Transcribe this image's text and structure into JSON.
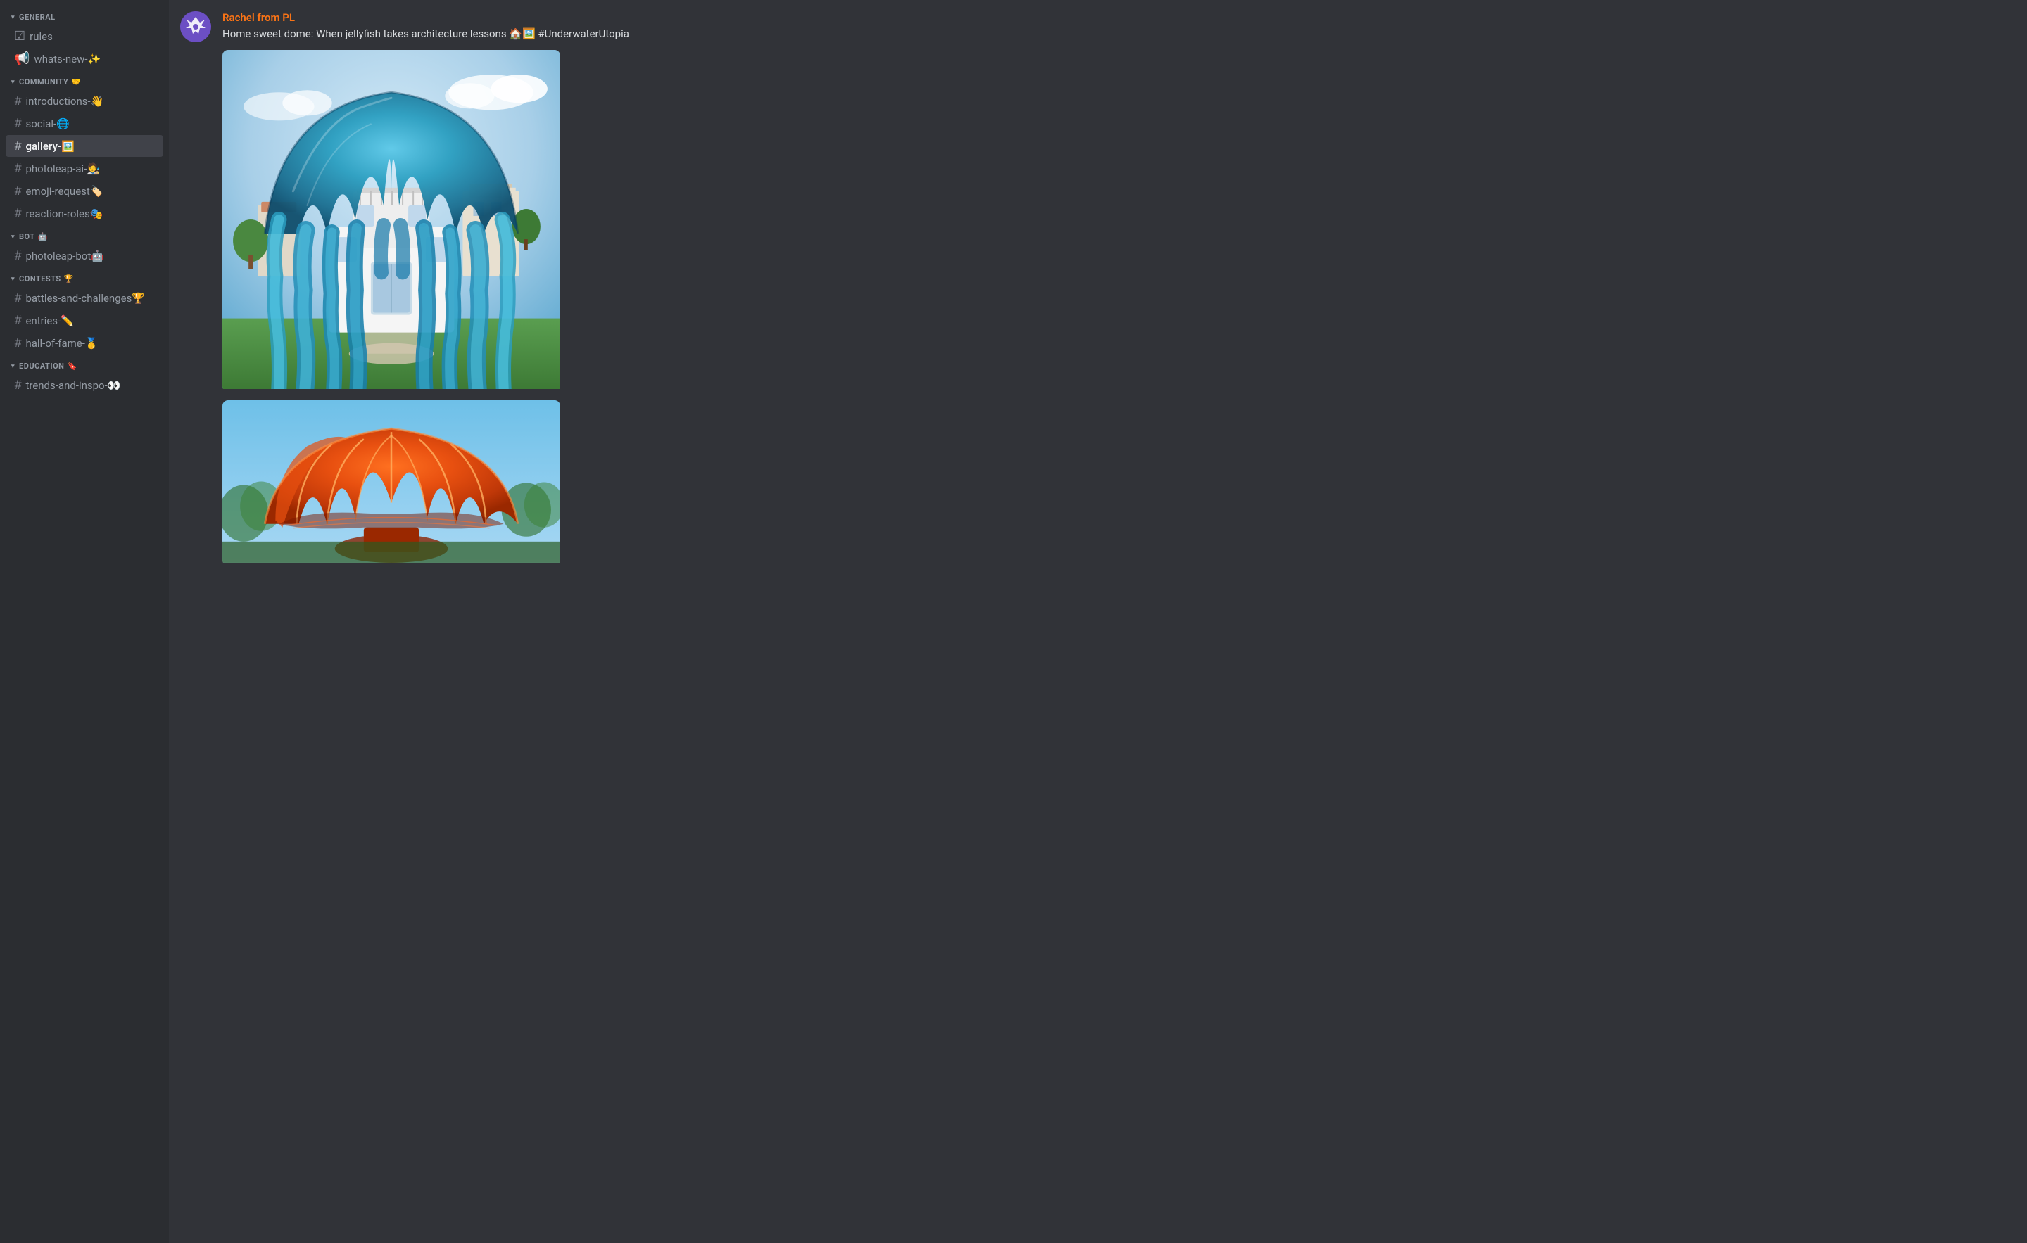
{
  "sidebar": {
    "sections": [
      {
        "id": "general",
        "label": "GENERAL",
        "emoji": "",
        "collapsed": false,
        "items": [
          {
            "id": "rules",
            "name": "rules",
            "emoji": "",
            "icon": "📋",
            "active": false,
            "type": "announcement"
          },
          {
            "id": "whats-new",
            "name": "whats-new-✨",
            "emoji": "✨",
            "active": false,
            "type": "announcement"
          }
        ]
      },
      {
        "id": "community",
        "label": "COMMUNITY",
        "emoji": "🤝",
        "collapsed": false,
        "items": [
          {
            "id": "introductions",
            "name": "introductions-👋",
            "emoji": "👋",
            "active": false,
            "type": "channel"
          },
          {
            "id": "social",
            "name": "social-🌐",
            "emoji": "🌐",
            "active": false,
            "type": "channel"
          },
          {
            "id": "gallery",
            "name": "gallery-🖼️",
            "emoji": "🖼️",
            "active": true,
            "type": "channel"
          },
          {
            "id": "photoleap-ai",
            "name": "photoleap-ai-🧑‍🎨",
            "emoji": "🧑‍🎨",
            "active": false,
            "type": "channel"
          },
          {
            "id": "emoji-request",
            "name": "emoji-request🏷️",
            "emoji": "🏷️",
            "active": false,
            "type": "channel"
          },
          {
            "id": "reaction-roles",
            "name": "reaction-roles🎭",
            "emoji": "🎭",
            "active": false,
            "type": "channel"
          }
        ]
      },
      {
        "id": "bot",
        "label": "BOT",
        "emoji": "🤖",
        "collapsed": false,
        "items": [
          {
            "id": "photoleap-bot",
            "name": "photoleap-bot🤖",
            "emoji": "🤖",
            "active": false,
            "type": "channel"
          }
        ]
      },
      {
        "id": "contests",
        "label": "CONTESTS",
        "emoji": "🏆",
        "collapsed": false,
        "items": [
          {
            "id": "battles-and-challenges",
            "name": "battles-and-challenges🏆",
            "emoji": "🏆",
            "active": false,
            "type": "channel"
          },
          {
            "id": "entries",
            "name": "entries-✏️",
            "emoji": "✏️",
            "active": false,
            "type": "channel"
          },
          {
            "id": "hall-of-fame",
            "name": "hall-of-fame-🥇",
            "emoji": "🥇",
            "active": false,
            "type": "channel"
          }
        ]
      },
      {
        "id": "education",
        "label": "EDUCATION",
        "emoji": "🔖",
        "collapsed": false,
        "items": [
          {
            "id": "trends-and-inspo",
            "name": "trends-and-inspo-👀",
            "emoji": "👀",
            "active": false,
            "type": "channel"
          }
        ]
      }
    ]
  },
  "message": {
    "author": "Rachel from PL",
    "author_color": "#f97316",
    "text": "Home sweet dome: When jellyfish takes architecture lessons 🏠🖼️ #UnderwaterUtopia",
    "avatar_icon": "🔮",
    "avatar_bg": "#6c4fc4"
  }
}
